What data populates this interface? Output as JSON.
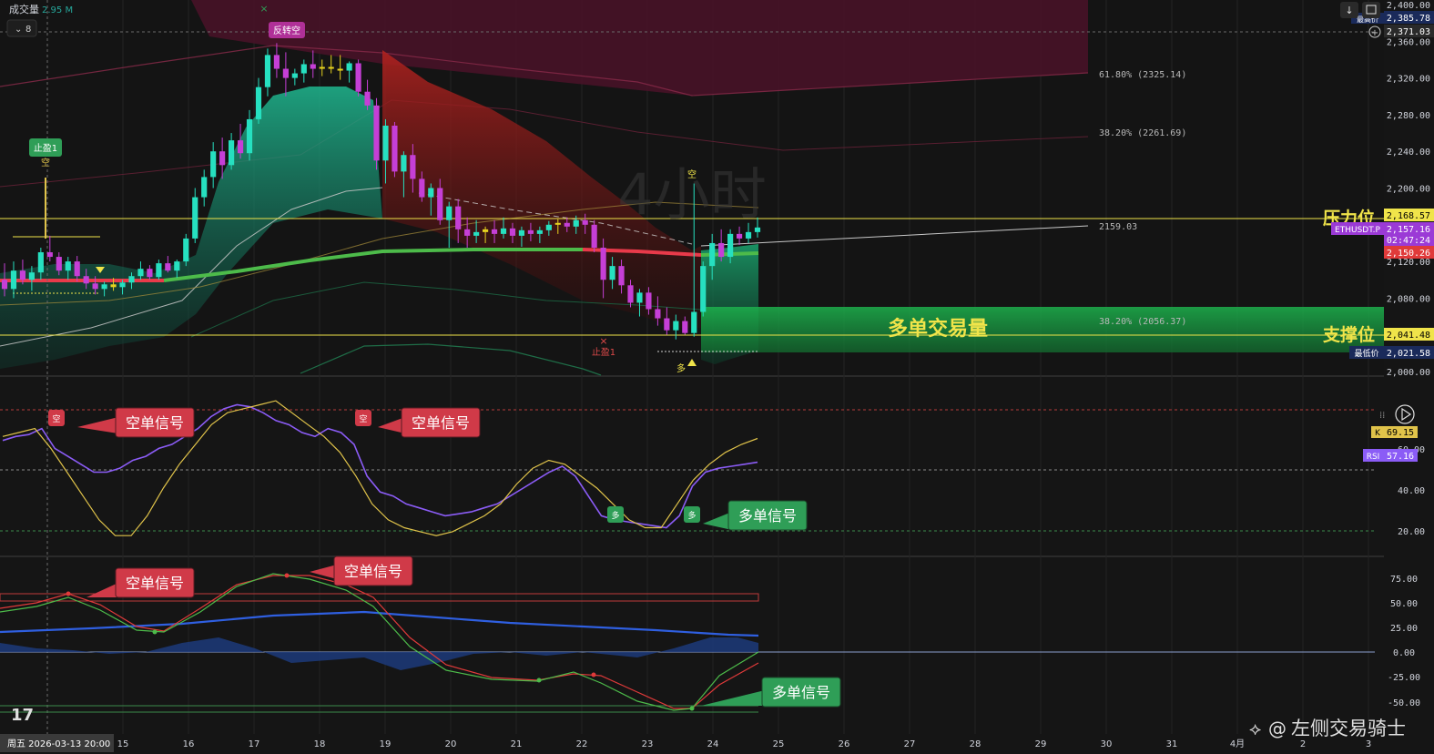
{
  "header": {
    "volume_label": "成交量",
    "volume_value": "2.95 M",
    "collapse_value": "8",
    "watermark": "4小时"
  },
  "colors": {
    "bg": "#151515",
    "up": "#26e0c0",
    "down": "#c53fd6",
    "neutral": "#e6d21f",
    "support_zone": "#1fa84a",
    "yellow_line": "#f0e44a",
    "resistance_zone": "#5a1430",
    "sell_signal": "#d03a48",
    "buy_signal": "#2f9e57",
    "rsi_line": "#8b5cf6",
    "k_line": "#e0c34a",
    "blue_line": "#2f5fe0"
  },
  "icons": [
    "download-icon",
    "fullscreen-icon",
    "plus-circle-icon",
    "play-icon",
    "settings-icon",
    "tradingview-logo-icon",
    "share-icon"
  ],
  "chart_data": [
    {
      "type": "candlestick",
      "symbol": "ETHUSDT.P",
      "timeframe": "4小时",
      "y_ticks": [
        "2,400.00",
        "2,360.00",
        "2,320.00",
        "2,280.00",
        "2,240.00",
        "2,200.00",
        "2,120.00",
        "2,080.00",
        "2,000.00"
      ],
      "ylim": [
        2000,
        2400
      ],
      "price_labels": {
        "highest_label": "最高价",
        "highest": "2,385.78",
        "crosshair": "2,371.03",
        "resistance_price": "2,168.57",
        "last_price": "2,157.16",
        "countdown": "02:47:24",
        "red_level": "2,150.26",
        "support_price": "2,041.48",
        "lowest_label": "最低价",
        "lowest": "2,021.58"
      },
      "fib_levels": [
        {
          "label": "61.80%",
          "price": "(2325.14)"
        },
        {
          "label": "38.20%",
          "price": "(2261.69)"
        },
        {
          "label": "2159.03",
          "price": ""
        },
        {
          "label": "38.20%",
          "price": "(2056.37)"
        }
      ],
      "annotations": {
        "resistance": "压力位",
        "support": "支撑位",
        "long_volume": "多单交易量",
        "take_profit_1": "止盈1",
        "take_profit_1b": "止盈1",
        "reversal_short": "反转空",
        "short_mark": "空",
        "long_mark": "多",
        "short_mark_small": "空"
      },
      "candles": [
        [
          2100,
          2118,
          2082,
          2090
        ],
        [
          2090,
          2120,
          2080,
          2110
        ],
        [
          2110,
          2122,
          2095,
          2100
        ],
        [
          2100,
          2115,
          2088,
          2108
        ],
        [
          2108,
          2135,
          2100,
          2130
        ],
        [
          2130,
          2148,
          2120,
          2125
        ],
        [
          2125,
          2130,
          2105,
          2110
        ],
        [
          2110,
          2125,
          2100,
          2120
        ],
        [
          2120,
          2126,
          2098,
          2104
        ],
        [
          2104,
          2112,
          2090,
          2096
        ],
        [
          2096,
          2104,
          2084,
          2090
        ],
        [
          2090,
          2098,
          2082,
          2095
        ],
        [
          2095,
          2102,
          2088,
          2092
        ],
        [
          2092,
          2100,
          2084,
          2097
        ],
        [
          2097,
          2108,
          2090,
          2104
        ],
        [
          2104,
          2120,
          2100,
          2112
        ],
        [
          2112,
          2116,
          2100,
          2103
        ],
        [
          2103,
          2122,
          2100,
          2118
        ],
        [
          2118,
          2126,
          2108,
          2110
        ],
        [
          2110,
          2122,
          2102,
          2120
        ],
        [
          2120,
          2150,
          2115,
          2145
        ],
        [
          2145,
          2200,
          2140,
          2190
        ],
        [
          2190,
          2220,
          2180,
          2212
        ],
        [
          2212,
          2250,
          2200,
          2240
        ],
        [
          2240,
          2255,
          2210,
          2225
        ],
        [
          2225,
          2260,
          2220,
          2252
        ],
        [
          2252,
          2270,
          2232,
          2238
        ],
        [
          2238,
          2285,
          2230,
          2275
        ],
        [
          2275,
          2320,
          2270,
          2310
        ],
        [
          2310,
          2352,
          2300,
          2345
        ],
        [
          2345,
          2358,
          2320,
          2330
        ],
        [
          2330,
          2348,
          2300,
          2320
        ],
        [
          2320,
          2330,
          2312,
          2325
        ],
        [
          2325,
          2340,
          2315,
          2335
        ],
        [
          2335,
          2350,
          2320,
          2330
        ],
        [
          2330,
          2340,
          2322,
          2332
        ],
        [
          2332,
          2345,
          2325,
          2330
        ],
        [
          2330,
          2345,
          2318,
          2328
        ],
        [
          2328,
          2338,
          2315,
          2336
        ],
        [
          2336,
          2340,
          2300,
          2305
        ],
        [
          2305,
          2318,
          2285,
          2290
        ],
        [
          2290,
          2298,
          2220,
          2230
        ],
        [
          2230,
          2275,
          2205,
          2268
        ],
        [
          2268,
          2272,
          2212,
          2218
        ],
        [
          2218,
          2240,
          2190,
          2236
        ],
        [
          2236,
          2248,
          2195,
          2210
        ],
        [
          2210,
          2218,
          2185,
          2190
        ],
        [
          2190,
          2205,
          2170,
          2200
        ],
        [
          2200,
          2210,
          2160,
          2165
        ],
        [
          2165,
          2185,
          2135,
          2180
        ],
        [
          2180,
          2188,
          2140,
          2155
        ],
        [
          2155,
          2168,
          2135,
          2148
        ],
        [
          2148,
          2165,
          2140,
          2152
        ],
        [
          2152,
          2158,
          2140,
          2155
        ],
        [
          2155,
          2165,
          2140,
          2150
        ],
        [
          2150,
          2168,
          2145,
          2156
        ],
        [
          2156,
          2162,
          2140,
          2148
        ],
        [
          2148,
          2158,
          2136,
          2154
        ],
        [
          2154,
          2162,
          2142,
          2150
        ],
        [
          2150,
          2158,
          2140,
          2154
        ],
        [
          2154,
          2164,
          2148,
          2160
        ],
        [
          2160,
          2166,
          2150,
          2162
        ],
        [
          2162,
          2168,
          2152,
          2158
        ],
        [
          2158,
          2170,
          2150,
          2165
        ],
        [
          2165,
          2172,
          2150,
          2160
        ],
        [
          2160,
          2165,
          2130,
          2135
        ],
        [
          2135,
          2145,
          2080,
          2100
        ],
        [
          2100,
          2125,
          2090,
          2115
        ],
        [
          2115,
          2122,
          2085,
          2094
        ],
        [
          2094,
          2100,
          2070,
          2075
        ],
        [
          2075,
          2090,
          2060,
          2086
        ],
        [
          2086,
          2092,
          2062,
          2068
        ],
        [
          2068,
          2082,
          2050,
          2058
        ],
        [
          2058,
          2070,
          2040,
          2045
        ],
        [
          2045,
          2062,
          2035,
          2055
        ],
        [
          2055,
          2060,
          2040,
          2042
        ],
        [
          2042,
          2205,
          2038,
          2065
        ],
        [
          2065,
          2120,
          2060,
          2115
        ],
        [
          2115,
          2150,
          2100,
          2140
        ],
        [
          2140,
          2155,
          2120,
          2125
        ],
        [
          2125,
          2155,
          2118,
          2150
        ],
        [
          2150,
          2158,
          2138,
          2145
        ],
        [
          2145,
          2162,
          2140,
          2152
        ],
        [
          2152,
          2168,
          2146,
          2157
        ]
      ]
    },
    {
      "type": "line",
      "name": "RSI",
      "y_ticks": [
        "40.00",
        "20.00"
      ],
      "partial_tick": "60.00",
      "labels": {
        "k": "K",
        "k_value": "69.15",
        "rsi": "RSI",
        "rsi_value": "57.16"
      },
      "series": [
        {
          "name": "RSI",
          "values": [
            68,
            70,
            71,
            74,
            64,
            60,
            56,
            52,
            52,
            54,
            58,
            60,
            64,
            66,
            70,
            74,
            80,
            84,
            86,
            85,
            82,
            78,
            76,
            72,
            70,
            74,
            72,
            66,
            50,
            42,
            40,
            36,
            34,
            32,
            30,
            31,
            32,
            34,
            36,
            40,
            44,
            48,
            52,
            55,
            50,
            40,
            30,
            28,
            27,
            26,
            25,
            24,
            30,
            45,
            52,
            54,
            55,
            56,
            57
          ]
        },
        {
          "name": "K",
          "values": [
            70,
            72,
            74,
            64,
            52,
            40,
            28,
            20,
            20,
            30,
            44,
            56,
            66,
            76,
            82,
            84,
            86,
            88,
            82,
            76,
            70,
            62,
            50,
            36,
            28,
            24,
            22,
            20,
            22,
            26,
            30,
            36,
            46,
            54,
            58,
            56,
            50,
            44,
            36,
            28,
            24,
            24,
            36,
            48,
            56,
            62,
            66,
            69
          ]
        }
      ],
      "ylim": [
        10,
        100
      ]
    },
    {
      "type": "line",
      "name": "oscillator",
      "y_ticks": [
        "75.00",
        "50.00",
        "25.00",
        "0.00",
        "-25.00",
        "-50.00"
      ],
      "ylim": [
        -65,
        90
      ]
    }
  ],
  "signals": {
    "short_1": "空单信号",
    "short_2": "空单信号",
    "long_1": "多单信号",
    "short_3": "空单信号",
    "short_4": "空单信号",
    "long_2": "多单信号",
    "signal_glyph_short": "空",
    "signal_glyph_long": "多"
  },
  "x_axis": {
    "date_label": "周五 2026-03-13 20:00",
    "ticks": [
      "15",
      "16",
      "17",
      "18",
      "19",
      "20",
      "21",
      "22",
      "23",
      "24",
      "25",
      "26",
      "27",
      "28",
      "29",
      "30",
      "31",
      "4月",
      "2",
      "3"
    ]
  },
  "footer": {
    "logo": "17",
    "watermark_at": "@",
    "watermark_name": "左侧交易骑士"
  }
}
